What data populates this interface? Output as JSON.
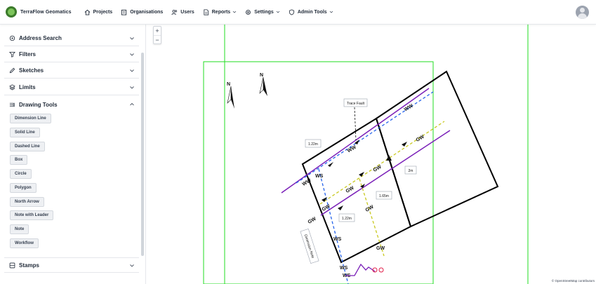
{
  "app": {
    "brand": "TerraFlow Geomatics"
  },
  "nav": {
    "projects": "Projects",
    "organisations": "Organisations",
    "users": "Users",
    "reports": "Reports",
    "settings": "Settings",
    "admin_tools": "Admin Tools"
  },
  "sidebar": {
    "address_search": "Address Search",
    "filters": "Filters",
    "sketches": "Sketches",
    "limits": "Limits",
    "drawing_tools": "Drawing Tools",
    "stamps": "Stamps",
    "tools": [
      "Dimension Line",
      "Solid Line",
      "Dashed Line",
      "Box",
      "Circle",
      "Polygon",
      "North Arrow",
      "Note with Leader",
      "Note",
      "Workflow"
    ]
  },
  "map": {
    "zoom_in": "+",
    "zoom_out": "−",
    "attribution": "© OpenStreetMap contributors",
    "north_label": "N",
    "notes": {
      "trace_fault": "Trace Fault",
      "dim_1": "1.22m",
      "dim_2": "2m",
      "dim_3": "1.65m",
      "dim_4": "1.22m",
      "dimension_note": "Dimension Note"
    },
    "labels": {
      "ww": "WW",
      "gw": "GW",
      "ws": "WS"
    },
    "colors": {
      "limit_green": "#22dd22",
      "purple": "#7a1fb8",
      "blue_dashed": "#2563eb",
      "yellow_dashed": "#c8c81e",
      "outline": "#000000"
    }
  }
}
